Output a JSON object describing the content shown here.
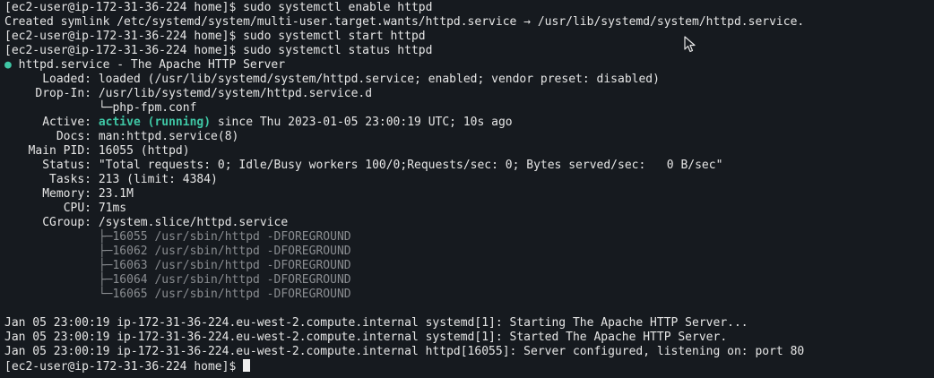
{
  "prompt": "[ec2-user@ip-172-31-36-224 home]$ ",
  "commands": {
    "enable": "sudo systemctl enable httpd",
    "start": "sudo systemctl start httpd",
    "status": "sudo systemctl status httpd"
  },
  "symlink_line": "Created symlink /etc/systemd/system/multi-user.target.wants/httpd.service → /usr/lib/systemd/system/httpd.service.",
  "status": {
    "dot": "●",
    "header": "httpd.service - The Apache HTTP Server",
    "loaded_label": "Loaded:",
    "loaded_value": "loaded (/usr/lib/systemd/system/httpd.service; enabled; vendor preset: disabled)",
    "dropin_label": "Drop-In:",
    "dropin_value": "/usr/lib/systemd/system/httpd.service.d",
    "dropin_tree": "└─",
    "dropin_file": "php-fpm.conf",
    "active_label": "Active:",
    "active_state": "active (running)",
    "active_since": " since Thu 2023-01-05 23:00:19 UTC; 10s ago",
    "docs_label": "Docs:",
    "docs_value": "man:httpd.service(8)",
    "pid_label": "Main PID:",
    "pid_value": "16055 (httpd)",
    "status_label": "Status:",
    "status_value": "\"Total requests: 0; Idle/Busy workers 100/0;Requests/sec: 0; Bytes served/sec:   0 B/sec\"",
    "tasks_label": "Tasks:",
    "tasks_value": "213 (limit: 4384)",
    "memory_label": "Memory:",
    "memory_value": "23.1M",
    "cpu_label": "CPU:",
    "cpu_value": "71ms",
    "cgroup_label": "CGroup:",
    "cgroup_value": "/system.slice/httpd.service",
    "processes": [
      {
        "tree": "├─",
        "text": "16055 /usr/sbin/httpd -DFOREGROUND"
      },
      {
        "tree": "├─",
        "text": "16062 /usr/sbin/httpd -DFOREGROUND"
      },
      {
        "tree": "├─",
        "text": "16063 /usr/sbin/httpd -DFOREGROUND"
      },
      {
        "tree": "├─",
        "text": "16064 /usr/sbin/httpd -DFOREGROUND"
      },
      {
        "tree": "└─",
        "text": "16065 /usr/sbin/httpd -DFOREGROUND"
      }
    ]
  },
  "journal": [
    "Jan 05 23:00:19 ip-172-31-36-224.eu-west-2.compute.internal systemd[1]: Starting The Apache HTTP Server...",
    "Jan 05 23:00:19 ip-172-31-36-224.eu-west-2.compute.internal systemd[1]: Started The Apache HTTP Server.",
    "Jan 05 23:00:19 ip-172-31-36-224.eu-west-2.compute.internal httpd[16055]: Server configured, listening on: port 80"
  ],
  "colors": {
    "background": "#161a1f",
    "text": "#e6e6e6",
    "active_green": "#3fc7a5",
    "dim_gray": "#8a8d91"
  },
  "icons": {
    "cursor": "block-cursor-icon",
    "mouse": "mouse-pointer-icon"
  }
}
